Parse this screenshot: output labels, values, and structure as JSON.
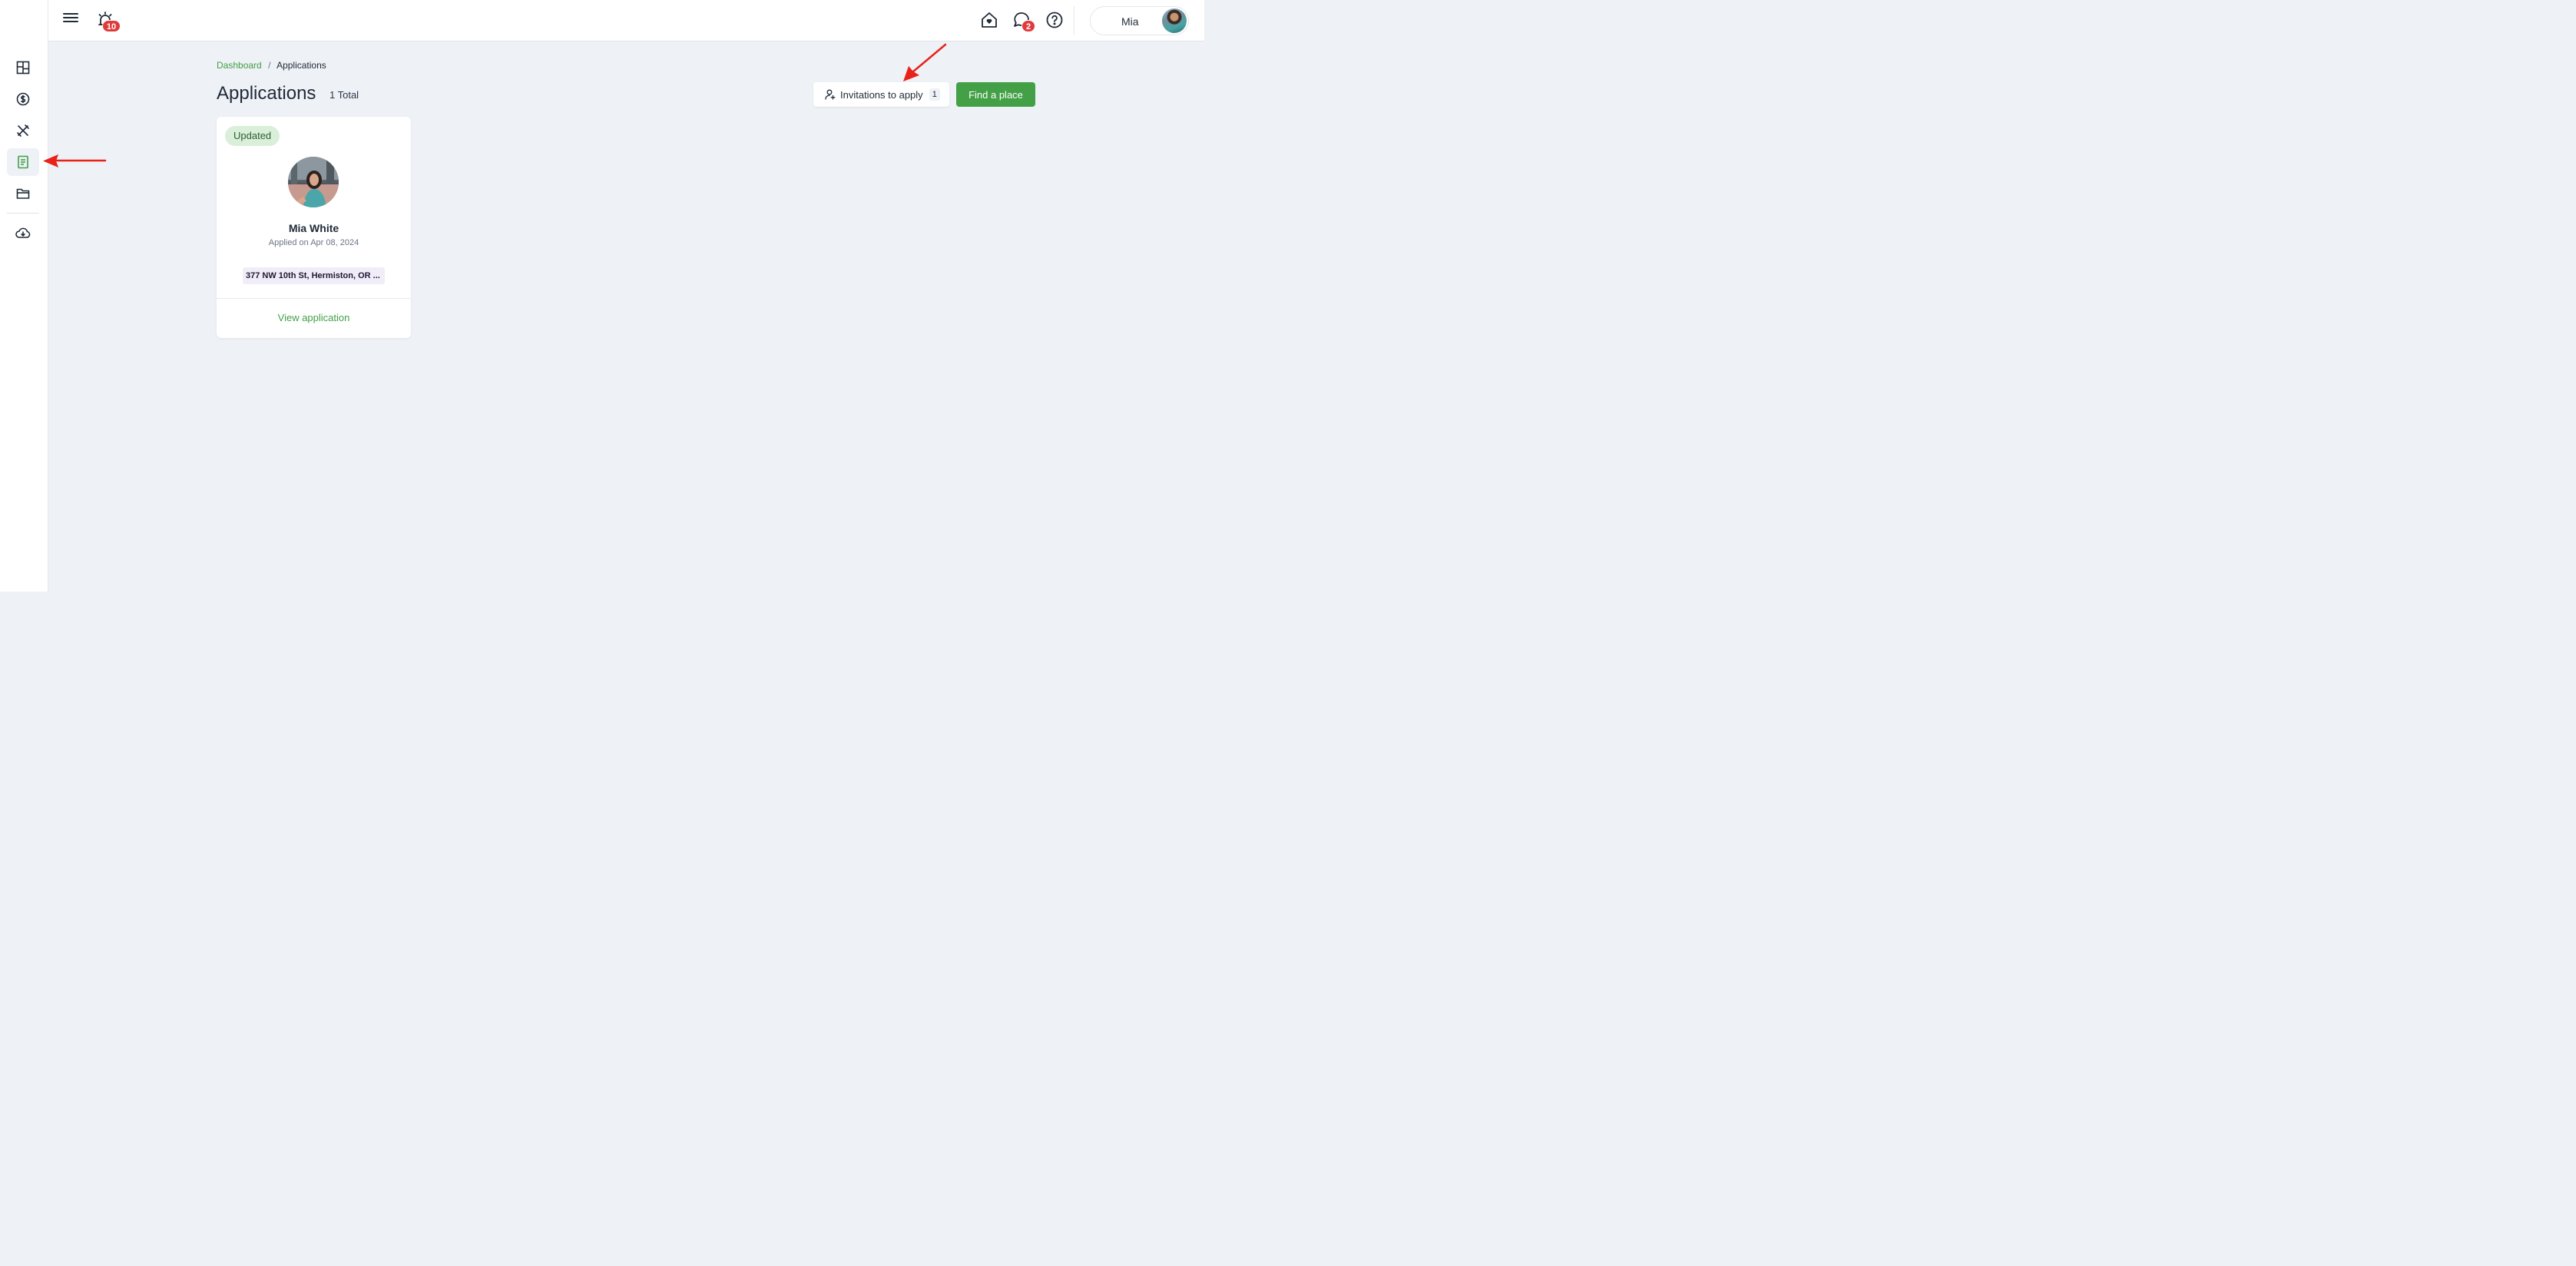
{
  "header": {
    "notifications_count": "10",
    "messages_count": "2",
    "user_name": "Mia"
  },
  "breadcrumb": {
    "root": "Dashboard",
    "separator": "/",
    "current": "Applications"
  },
  "page": {
    "title": "Applications",
    "total": "1 Total"
  },
  "actions": {
    "invitations_label": "Invitations to apply",
    "invitations_count": "1",
    "find_place_label": "Find a place"
  },
  "application_card": {
    "status": "Updated",
    "applicant_name": "Mia White",
    "applied_on": "Applied on Apr 08, 2024",
    "address": "377 NW 10th St, Hermiston, OR ...",
    "view_label": "View application"
  },
  "sidebar": {
    "items": [
      {
        "icon": "dashboard-icon"
      },
      {
        "icon": "dollar-icon"
      },
      {
        "icon": "tools-icon"
      },
      {
        "icon": "document-icon",
        "active": true
      },
      {
        "icon": "folder-icon"
      },
      {
        "icon": "cloud-download-icon"
      }
    ]
  },
  "colors": {
    "accent": "#43a047",
    "badge": "#e03b3b",
    "background": "#eef1f6",
    "annotation": "#e8221a"
  }
}
